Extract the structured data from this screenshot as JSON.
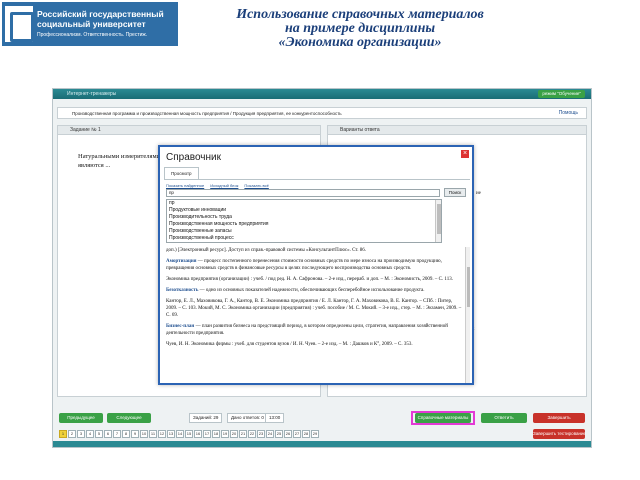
{
  "header": {
    "logo_line1": "Российский государственный",
    "logo_line2": "социальный университет",
    "logo_tagline": "Профессионализм. Ответственность. Престиж.",
    "title_line1": "Использование справочных материалов",
    "title_line2": "на примере дисциплины",
    "title_line3": "«Экономика организации»"
  },
  "app": {
    "window_title": "Интернет-тренажеры",
    "mode": "режим \"Обучение\"",
    "task_path": "Производственная программа и производственная мощность предприятия / Продукция предприятия, ее конкурентоспособность",
    "help": "Помощь",
    "left_panel_title": "Задание № 1",
    "right_panel_title": "Варианты ответа",
    "question": "Натуральными измерителями являются ..."
  },
  "bottom": {
    "btn_prev": "Предыдущее",
    "btn_next": "Следующее",
    "task_count": "Заданий: 29",
    "answered": "Дано ответов: 0",
    "time": "13:00",
    "btn_reference": "Справочные материалы",
    "btn_answer": "Ответить",
    "btn_finish": "Завершить",
    "btn_stop": "Завершить тестирование",
    "question_numbers": [
      "1",
      "2",
      "3",
      "4",
      "5",
      "6",
      "7",
      "8",
      "9",
      "10",
      "11",
      "12",
      "13",
      "14",
      "15",
      "16",
      "17",
      "18",
      "19",
      "20",
      "21",
      "22",
      "23",
      "24",
      "25",
      "26",
      "27",
      "28",
      "29"
    ]
  },
  "dialog": {
    "title": "Справочник",
    "close": "×",
    "tab": "Просмотр",
    "link_show_all": "Показать найденное",
    "link_contents": "Исходный блок",
    "link_print": "Показать всё",
    "search_value": "пр",
    "search_button": "Поиск",
    "list_items": [
      "пр",
      "Продуктовые инновации",
      "Производительность труда",
      "Производственная мощность предприятия",
      "Производственные запасы",
      "Производственный процесс",
      "Промышленно-производственный персонал"
    ],
    "article_intro": "доп.) [Электронный ресурс]. Доступ из справ.-правовой системы «КонсультантПлюс». Ст. 86.",
    "entries": [
      {
        "term": "Амортизация",
        "text": " — процесс постепенного перенесения стоимости основных средств по мере износа на производимую продукцию, превращения основных средств в финансовые ресурсы в целях последующего воспроизводства основных средств.",
        "source": "Экономика предприятия (организации) : учеб. / под ред. Н. А. Сафронова. – 2-е изд., перераб. и доп. – М. : Экономистъ, 2009. – С. 113."
      },
      {
        "term": "Безотказность",
        "text": " — одно из основных показателей надежности, обеспечивающих бесперебойное использование продукта.",
        "source": "Кантор, Е. Л., Маховикова, Г. А., Кантор, В. Е. Экономика предприятия / Е. Л. Кантор, Г. А. Маховикова, В. Е. Кантор. – СПб. : Питер, 2009. – С. 103. Мокий, М. С. Экономика организации (предприятия) : учеб. пособие / М. С. Мокий. – 3-е изд., стер. – М. : Экзамен, 2009. – С. 69."
      },
      {
        "term": "Бизнес-план",
        "text": " — план развития бизнеса на предстоящий период, в котором определены цели, стратегия, направления хозяйственной деятельности предприятия.",
        "source": "Чуев, И. Н. Экономика фирмы : учеб. для студентов вузов / И. Н. Чуев. – 2-е изд. – М. : Дашков и К°, 2009. – С. 353."
      }
    ]
  },
  "right_panel_fragments": {
    "frag1": "ие",
    "frag2": "ч, в",
    "frag3": "ик",
    "frag4": "к"
  },
  "colors": {
    "brand_blue": "#2f6ea6",
    "title_blue": "#1b3f7a",
    "teal": "#2b8a93",
    "green": "#3aa146",
    "red": "#c8322a",
    "highlight": "#e339d5"
  }
}
